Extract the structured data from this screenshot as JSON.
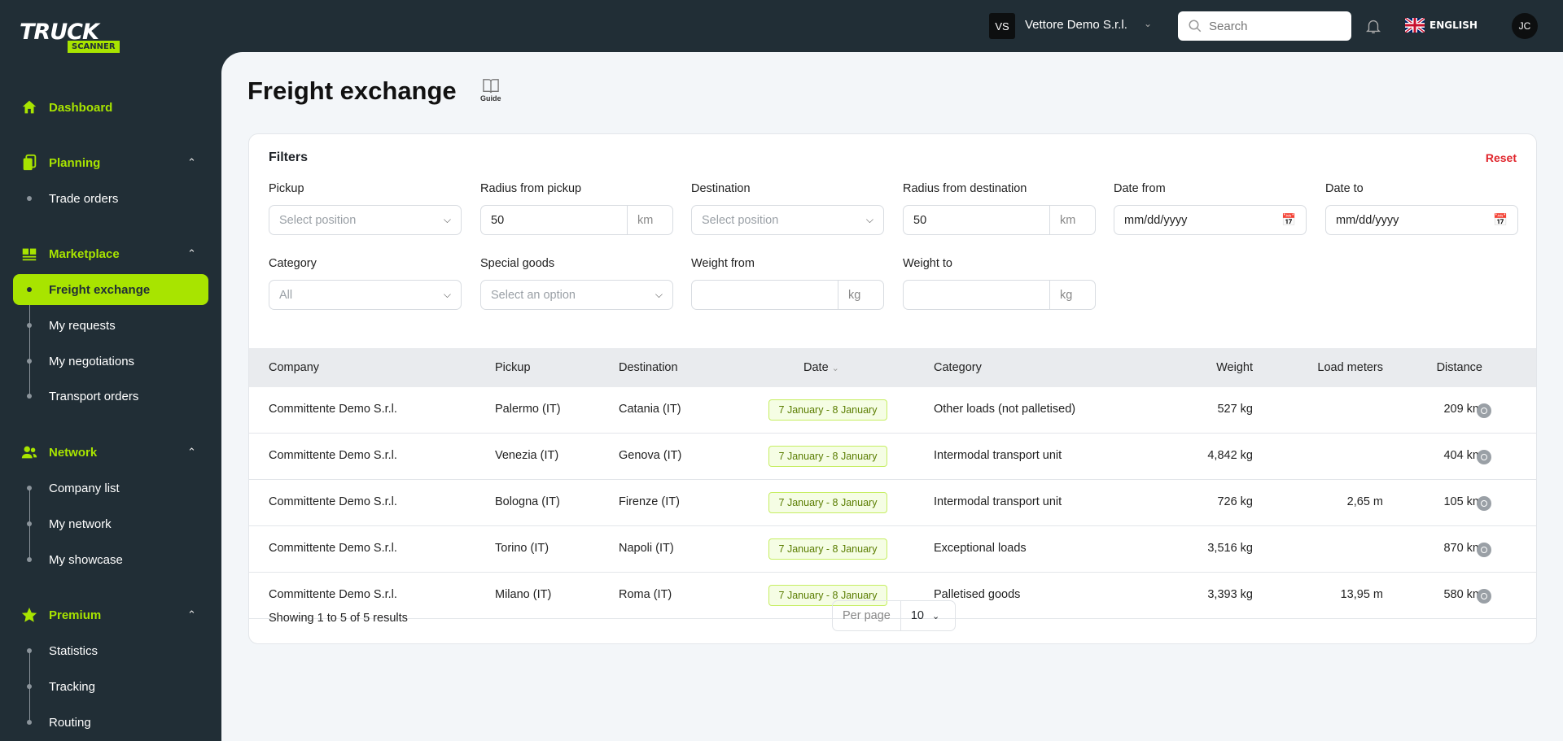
{
  "logo": {
    "top": "TRUCK",
    "bottom": "SCANNER"
  },
  "sidebar": {
    "dashboard": "Dashboard",
    "planning": {
      "label": "Planning",
      "items": [
        "Trade orders"
      ]
    },
    "marketplace": {
      "label": "Marketplace",
      "items": [
        "Freight exchange",
        "My requests",
        "My negotiations",
        "Transport orders"
      ]
    },
    "network": {
      "label": "Network",
      "items": [
        "Company list",
        "My network",
        "My showcase"
      ]
    },
    "premium": {
      "label": "Premium",
      "items": [
        "Statistics",
        "Tracking",
        "Routing"
      ]
    }
  },
  "topbar": {
    "company_initials": "VS",
    "company": "Vettore Demo S.r.l.",
    "search_placeholder": "Search",
    "language": "ENGLISH",
    "user_initials": "JC"
  },
  "page": {
    "title": "Freight exchange",
    "guide": "Guide"
  },
  "filters": {
    "title": "Filters",
    "reset": "Reset",
    "pickup": {
      "label": "Pickup",
      "placeholder": "Select position"
    },
    "radius_pickup": {
      "label": "Radius from pickup",
      "value": "50",
      "unit": "km"
    },
    "destination": {
      "label": "Destination",
      "placeholder": "Select position"
    },
    "radius_destination": {
      "label": "Radius from destination",
      "value": "50",
      "unit": "km"
    },
    "date_from": {
      "label": "Date from",
      "placeholder": "mm/dd/yyyy"
    },
    "date_to": {
      "label": "Date to",
      "placeholder": "mm/dd/yyyy"
    },
    "category": {
      "label": "Category",
      "value": "All"
    },
    "special_goods": {
      "label": "Special goods",
      "placeholder": "Select an option"
    },
    "weight_from": {
      "label": "Weight from",
      "unit": "kg"
    },
    "weight_to": {
      "label": "Weight to",
      "unit": "kg"
    }
  },
  "table": {
    "headers": {
      "company": "Company",
      "pickup": "Pickup",
      "destination": "Destination",
      "date": "Date",
      "category": "Category",
      "weight": "Weight",
      "load_meters": "Load meters",
      "distance": "Distance"
    },
    "rows": [
      {
        "company": "Committente Demo S.r.l.",
        "pickup": "Palermo (IT)",
        "destination": "Catania (IT)",
        "date": "7 January - 8 January",
        "category": "Other loads (not palletised)",
        "weight": "527 kg",
        "load_meters": "",
        "distance": "209 km"
      },
      {
        "company": "Committente Demo S.r.l.",
        "pickup": "Venezia (IT)",
        "destination": "Genova (IT)",
        "date": "7 January - 8 January",
        "category": "Intermodal transport unit",
        "weight": "4,842 kg",
        "load_meters": "",
        "distance": "404 km"
      },
      {
        "company": "Committente Demo S.r.l.",
        "pickup": "Bologna (IT)",
        "destination": "Firenze (IT)",
        "date": "7 January - 8 January",
        "category": "Intermodal transport unit",
        "weight": "726 kg",
        "load_meters": "2,65 m",
        "distance": "105 km"
      },
      {
        "company": "Committente Demo S.r.l.",
        "pickup": "Torino (IT)",
        "destination": "Napoli (IT)",
        "date": "7 January - 8 January",
        "category": "Exceptional loads",
        "weight": "3,516 kg",
        "load_meters": "",
        "distance": "870 km"
      },
      {
        "company": "Committente Demo S.r.l.",
        "pickup": "Milano (IT)",
        "destination": "Roma (IT)",
        "date": "7 January - 8 January",
        "category": "Palletised goods",
        "weight": "3,393 kg",
        "load_meters": "13,95 m",
        "distance": "580 km"
      }
    ],
    "showing": "Showing 1 to 5 of 5 results",
    "per_page_label": "Per page",
    "per_page": "10"
  },
  "colors": {
    "accent": "#a8e400",
    "sidebar": "#212e36",
    "danger": "#e0242b"
  }
}
